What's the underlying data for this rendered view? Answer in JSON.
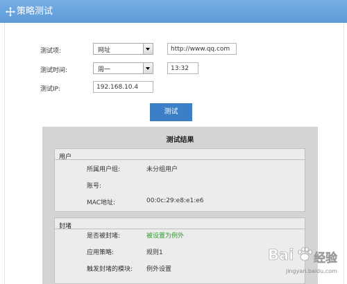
{
  "title": "策略测试",
  "form": {
    "test_item_label": "测试项:",
    "test_item_value": "网址",
    "url_value": "http://www.qq.com",
    "test_time_label": "测试时间:",
    "weekday_value": "周一",
    "time_value": "13:32",
    "test_ip_label": "测试IP:",
    "ip_value": "192.168.10.4",
    "test_button": "测试"
  },
  "result": {
    "title": "测试结果",
    "user_group": {
      "title": "用户",
      "rows": [
        {
          "label": "所属用户组:",
          "value": "未分组用户"
        },
        {
          "label": "账号:",
          "value": ""
        },
        {
          "label": "MAC地址:",
          "value": "00:0c:29:e8:e1:e6"
        }
      ]
    },
    "block_group": {
      "title": "封堵",
      "rows": [
        {
          "label": "是否被封堵:",
          "value": "被设置为例外"
        },
        {
          "label": "应用策略:",
          "value": "规则1"
        },
        {
          "label": "触发封堵的模块:",
          "value": "例外设置"
        }
      ]
    }
  },
  "watermark": {
    "brand": "Bai",
    "suffix": "经验",
    "url": "jingyan.baidu.com"
  },
  "colors": {
    "titlebar": "#6aa5df",
    "button": "#3b7fc7",
    "exception": "#2e9a2e"
  }
}
